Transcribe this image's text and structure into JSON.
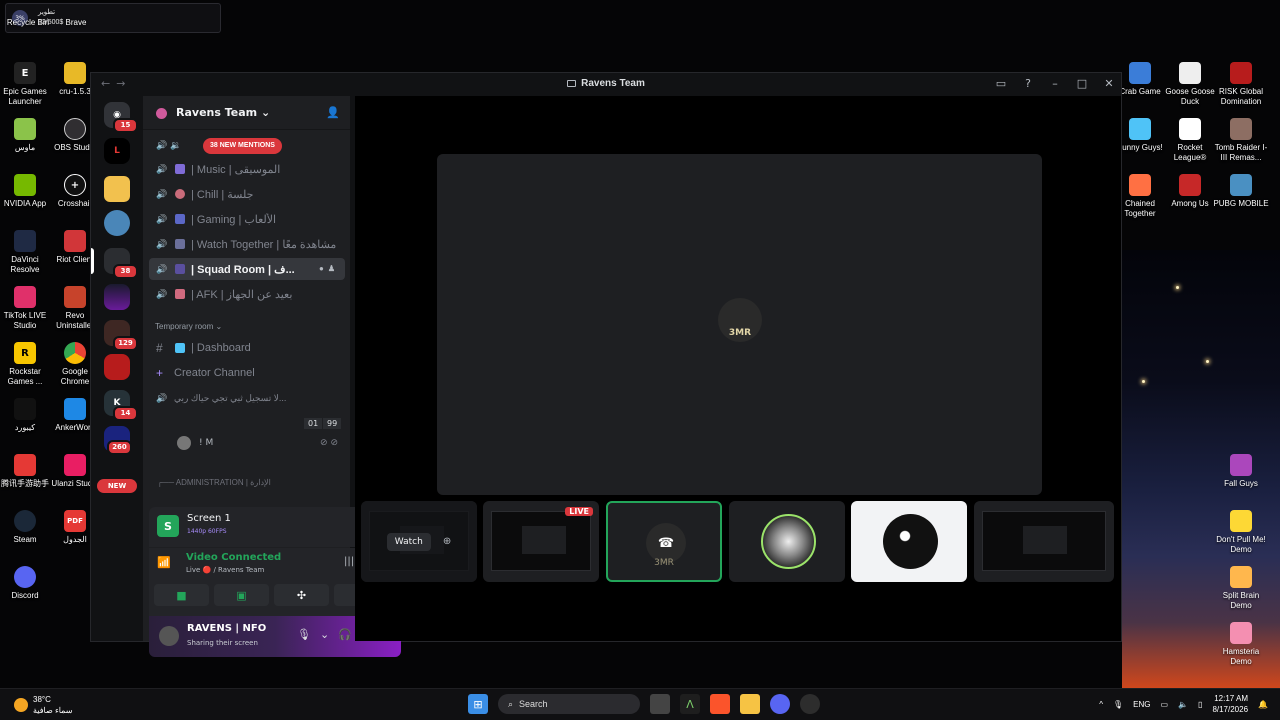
{
  "notification": {
    "percent": "3%",
    "line1": "تطوير",
    "line2": "13/500$"
  },
  "desktop_left": [
    {
      "label": "Recycle Bin",
      "icon": "recycle-bin-icon"
    },
    {
      "label": "Brave",
      "icon": "brave-icon"
    },
    {
      "label": "Epic Games Launcher",
      "icon": "epic-games-icon"
    },
    {
      "label": "cru-1.5.3",
      "icon": "folder-icon"
    },
    {
      "label": "ماوس",
      "icon": "mouse-app-icon"
    },
    {
      "label": "OBS Studio",
      "icon": "obs-icon"
    },
    {
      "label": "NVIDIA App",
      "icon": "nvidia-icon"
    },
    {
      "label": "Crosshair",
      "icon": "crosshair-icon"
    },
    {
      "label": "DaVinci Resolve",
      "icon": "davinci-icon"
    },
    {
      "label": "Riot Client",
      "icon": "riot-icon"
    },
    {
      "label": "TikTok LIVE Studio",
      "icon": "tiktok-icon"
    },
    {
      "label": "Revo Uninstaller",
      "icon": "revo-icon"
    },
    {
      "label": "Rockstar Games ...",
      "icon": "rockstar-icon"
    },
    {
      "label": "Google Chrome",
      "icon": "chrome-icon"
    },
    {
      "label": "كيبورد",
      "icon": "keyboard-app-icon"
    },
    {
      "label": "AnkerWork",
      "icon": "anker-icon"
    },
    {
      "label": "腾讯手游助手",
      "icon": "tencent-icon"
    },
    {
      "label": "Ulanzi Studio",
      "icon": "ulanzi-icon"
    },
    {
      "label": "Steam",
      "icon": "steam-icon"
    },
    {
      "label": "الجدول",
      "icon": "pdf-icon"
    },
    {
      "label": "Discord",
      "icon": "discord-icon"
    }
  ],
  "desktop_right": [
    {
      "label": "Crab Game",
      "icon": "crab-game-icon"
    },
    {
      "label": "Goose Goose Duck",
      "icon": "goose-icon"
    },
    {
      "label": "RISK Global Domination",
      "icon": "risk-icon"
    },
    {
      "label": "Funny Guys!",
      "icon": "funny-guys-icon"
    },
    {
      "label": "Rocket League®",
      "icon": "rocket-league-icon"
    },
    {
      "label": "Tomb Raider I-III Remas...",
      "icon": "tomb-raider-icon"
    },
    {
      "label": "Chained Together",
      "icon": "chained-icon"
    },
    {
      "label": "Among Us",
      "icon": "among-us-icon"
    },
    {
      "label": "PUBG MOBILE",
      "icon": "pubg-icon"
    },
    {
      "label": "Fall Guys",
      "icon": "fall-guys-icon"
    },
    {
      "label": "Don't Pull Me! Demo",
      "icon": "dont-pull-icon"
    },
    {
      "label": "Split Brain Demo",
      "icon": "split-brain-icon"
    },
    {
      "label": "Hamsteria Demo",
      "icon": "hamsteria-icon"
    }
  ],
  "window": {
    "title": "Ravens Team",
    "back": "←",
    "forward": "→"
  },
  "rail": {
    "badges": [
      "15",
      "38",
      "129",
      "14",
      "260"
    ],
    "new_label": "NEW"
  },
  "server": {
    "name": "Ravens Team",
    "chevron": "⌄",
    "mentions": "38 NEW MENTIONS"
  },
  "channels": [
    {
      "label": "| Music | الموسيقى",
      "color": "#7f6bd6"
    },
    {
      "label": "| Chill | جلسة",
      "color": "#c96b7a"
    },
    {
      "label": "| Gaming | الألعاب",
      "color": "#5b67c7"
    },
    {
      "label": "| Watch Together | مشاهدة معًا",
      "color": "#6b6f9a"
    },
    {
      "label": "| Squad Room | ف...",
      "color": "#5a4f9e"
    },
    {
      "label": "| AFK | بعيد عن الجهاز",
      "color": "#d06a7f"
    }
  ],
  "temp_category": "Temporary room",
  "text_channels": [
    {
      "label": "| Dashboard",
      "icon": "#"
    },
    {
      "label": "Creator Channel",
      "icon": "+"
    }
  ],
  "voice_channel": {
    "label": "لا تسجيل ثبي تجي حياك ربي...",
    "count_a": "01",
    "count_b": "99"
  },
  "voice_user": "! M",
  "admin_category": "ADMINISTRATION | الإدارة",
  "stream_panel": {
    "title": "Screen 1",
    "sub": "1440p 60FPS",
    "thumb": "S"
  },
  "rtc": {
    "status": "Video Connected",
    "where": "Live 🔴 / Ravens Team"
  },
  "user": {
    "name": "RAVENS | NFO",
    "status": "Sharing their screen"
  },
  "stage": {
    "focus_label": "3MR",
    "watch_label": "Watch",
    "live_label": "LIVE",
    "tile_label": "3MR"
  },
  "taskbar": {
    "temp": "38°C",
    "weather": "سماء صافية",
    "search": "Search",
    "lang": "ENG",
    "time": "12:17 AM",
    "date": "8/17/2026"
  }
}
